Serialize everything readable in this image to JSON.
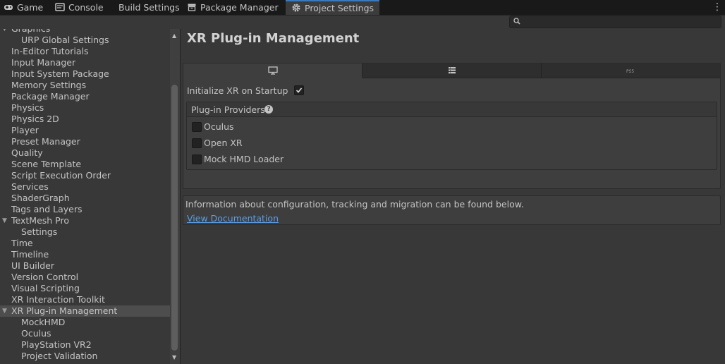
{
  "tabs": [
    {
      "label": "Game",
      "icon": "gamepad-icon"
    },
    {
      "label": "Console",
      "icon": "console-icon"
    },
    {
      "label": "Build Settings",
      "icon": ""
    },
    {
      "label": "Package Manager",
      "icon": "package-icon"
    },
    {
      "label": "Project Settings",
      "icon": "gear-icon",
      "active": true
    }
  ],
  "search": {
    "placeholder": ""
  },
  "sidebar": {
    "items": [
      {
        "label": "Graphics"
      },
      {
        "label": "URP Global Settings",
        "indent": true
      },
      {
        "label": "In-Editor Tutorials"
      },
      {
        "label": "Input Manager"
      },
      {
        "label": "Input System Package"
      },
      {
        "label": "Memory Settings"
      },
      {
        "label": "Package Manager"
      },
      {
        "label": "Physics"
      },
      {
        "label": "Physics 2D"
      },
      {
        "label": "Player"
      },
      {
        "label": "Preset Manager"
      },
      {
        "label": "Quality"
      },
      {
        "label": "Scene Template"
      },
      {
        "label": "Script Execution Order"
      },
      {
        "label": "Services"
      },
      {
        "label": "ShaderGraph"
      },
      {
        "label": "Tags and Layers"
      },
      {
        "label": "TextMesh Pro",
        "expanded": true
      },
      {
        "label": "Settings",
        "indent": true
      },
      {
        "label": "Time"
      },
      {
        "label": "Timeline"
      },
      {
        "label": "UI Builder"
      },
      {
        "label": "Version Control"
      },
      {
        "label": "Visual Scripting"
      },
      {
        "label": "XR Interaction Toolkit"
      },
      {
        "label": "XR Plug-in Management",
        "expanded": true,
        "selected": true
      },
      {
        "label": "MockHMD",
        "indent": true
      },
      {
        "label": "Oculus",
        "indent": true
      },
      {
        "label": "PlayStation VR2",
        "indent": true
      },
      {
        "label": "Project Validation",
        "indent": true
      }
    ]
  },
  "main": {
    "title": "XR Plug-in Management",
    "platform_tabs": [
      {
        "icon": "monitor-icon",
        "active": true
      },
      {
        "icon": "android-icon"
      },
      {
        "icon": "ps5-icon"
      }
    ],
    "init_label": "Initialize XR on Startup",
    "init_checked": true,
    "providers_title": "Plug-in Providers",
    "providers": [
      {
        "label": "Oculus",
        "checked": false
      },
      {
        "label": "Open XR",
        "checked": false
      },
      {
        "label": "Mock HMD Loader",
        "checked": false
      }
    ],
    "info_text": "Information about configuration, tracking and migration can be found below.",
    "doc_link": "View Documentation"
  },
  "colors": {
    "accent": "#3a79bb",
    "link": "#5a9ee8",
    "selected": "#4d4d4d"
  }
}
